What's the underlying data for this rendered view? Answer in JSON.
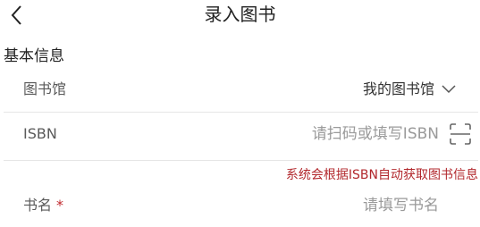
{
  "header": {
    "title": "录入图书",
    "back_icon": "chevron-left-icon"
  },
  "section": {
    "title": "基本信息"
  },
  "library_row": {
    "label": "图书馆",
    "value": "我的图书馆",
    "dropdown_icon": "chevron-down-icon"
  },
  "isbn_row": {
    "label": "ISBN",
    "placeholder": "请扫码或填写ISBN",
    "value": "",
    "scan_icon": "scan-icon"
  },
  "isbn_hint": "系统会根据ISBN自动获取图书信息",
  "title_row": {
    "label": "书名",
    "required_mark": "*",
    "placeholder": "请填写书名",
    "value": ""
  },
  "colors": {
    "hint": "#b2282d",
    "required": "#c0282d",
    "divider": "#e6e6e6",
    "placeholder": "#9a9a9a"
  }
}
